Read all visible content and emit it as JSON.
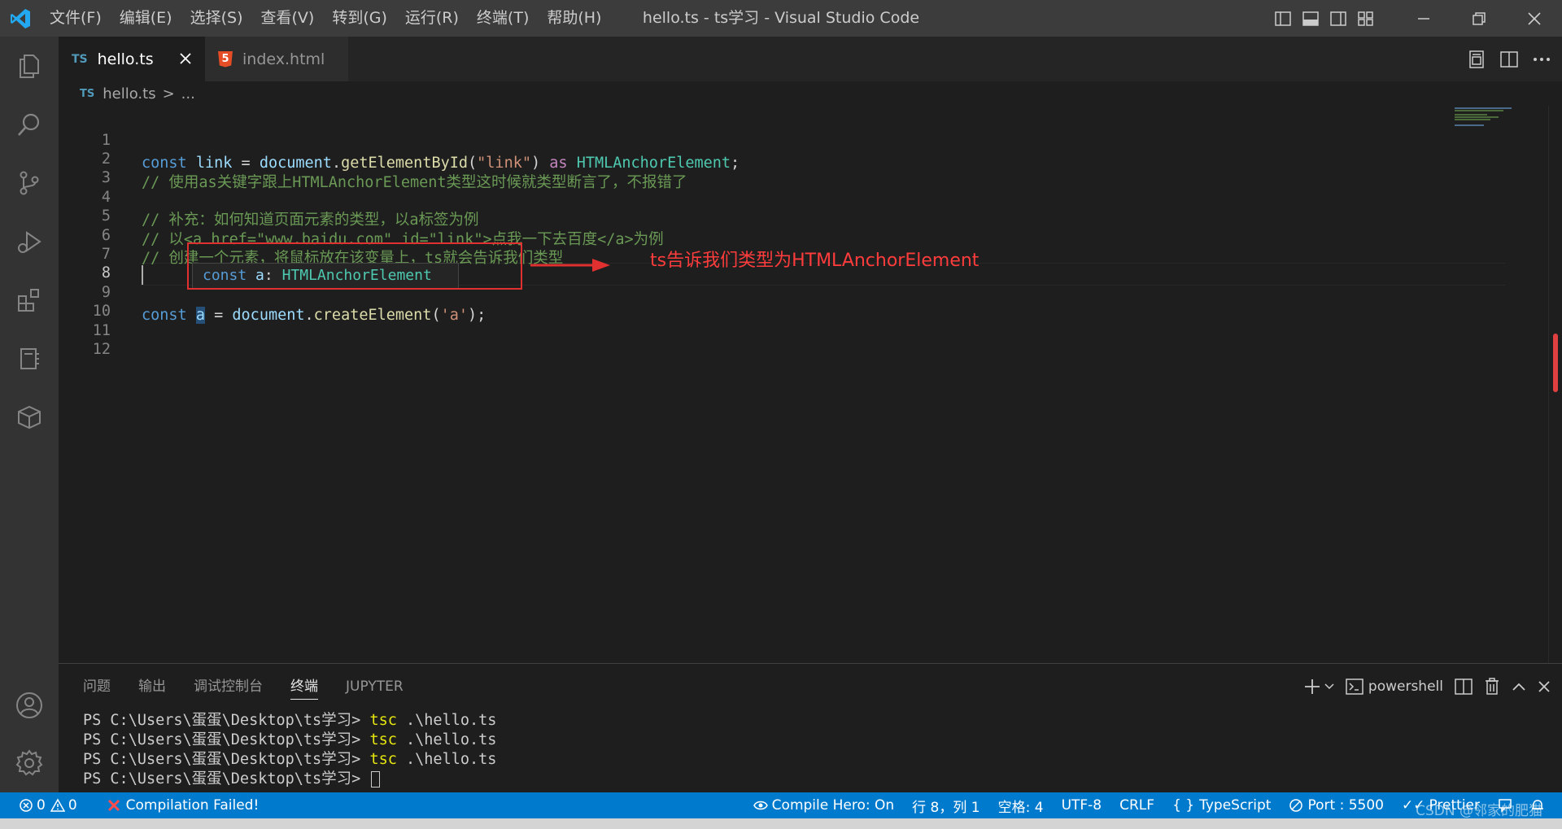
{
  "window": {
    "title": "hello.ts - ts学习 - Visual Studio Code",
    "menu": [
      "文件(F)",
      "编辑(E)",
      "选择(S)",
      "查看(V)",
      "转到(G)",
      "运行(R)",
      "终端(T)",
      "帮助(H)"
    ]
  },
  "tabs": [
    {
      "badge": "TS",
      "label": "hello.ts",
      "active": true
    },
    {
      "badge": "5",
      "label": "index.html",
      "active": false
    }
  ],
  "breadcrumb": {
    "badge": "TS",
    "file": "hello.ts",
    "sep": ">",
    "rest": "..."
  },
  "editor": {
    "line_numbers": [
      "1",
      "2",
      "3",
      "4",
      "5",
      "6",
      "7",
      "8",
      "9",
      "10",
      "11",
      "12"
    ],
    "active_line": "8",
    "line1": {
      "t1": "const",
      "t2": "link",
      "t3": "=",
      "t4": "document",
      "t5": ".",
      "t6": "getElementById",
      "t7": "(",
      "t8": "\"link\"",
      "t9": ")",
      "t10": "as",
      "t11": "HTMLAnchorElement",
      "t12": ";"
    },
    "line2": "// 使用as关键字跟上HTMLAnchorElement类型这时候就类型断言了，不报错了",
    "line4": "// 补充：如何知道页面元素的类型，以a标签为例",
    "line5": "// 以<a href=\"www.baidu.com\" id=\"link\">点我一下去百度</a>为例",
    "line6": "// 创建一个元素，将鼠标放在该变量上，ts就会告诉我们类型",
    "line9": {
      "t1": "const",
      "t2": "a",
      "t3": "=",
      "t4": "document",
      "t5": ".",
      "t6": "createElement",
      "t7": "(",
      "t8": "'a'",
      "t9": ");"
    }
  },
  "hover": {
    "kw": "const",
    "name": "a",
    "colon": ":",
    "type": "HTMLAnchorElement"
  },
  "annotation": {
    "text": "ts告诉我们类型为HTMLAnchorElement",
    "color": "#ff3c3c"
  },
  "panel": {
    "tabs": [
      "问题",
      "输出",
      "调试控制台",
      "终端",
      "JUPYTER"
    ],
    "active_tab": "终端",
    "shell": "powershell",
    "terminal_lines": [
      {
        "prompt": "PS C:\\Users\\蛋蛋\\Desktop\\ts学习> ",
        "cmd": "tsc",
        "args": " .\\hello.ts"
      },
      {
        "prompt": "PS C:\\Users\\蛋蛋\\Desktop\\ts学习> ",
        "cmd": "tsc",
        "args": " .\\hello.ts"
      },
      {
        "prompt": "PS C:\\Users\\蛋蛋\\Desktop\\ts学习> ",
        "cmd": "tsc",
        "args": " .\\hello.ts"
      }
    ],
    "last_prompt": "PS C:\\Users\\蛋蛋\\Desktop\\ts学习> "
  },
  "statusbar": {
    "errors": "0",
    "warnings": "0",
    "compile_status": "Compilation Failed!",
    "compile_hero": "Compile Hero: On",
    "position": "行 8，列 1",
    "spaces": "空格: 4",
    "encoding": "UTF-8",
    "eol": "CRLF",
    "language": "TypeScript",
    "port": "Port : 5500",
    "prettier": "Prettier"
  },
  "watermark": "CSDN @邻家的肥猫",
  "colors": {
    "accent": "#007acc",
    "titlebar": "#3c3c3c",
    "activitybar": "#333333",
    "editor_bg": "#1e1e1e",
    "annotation_red": "#e03030"
  }
}
